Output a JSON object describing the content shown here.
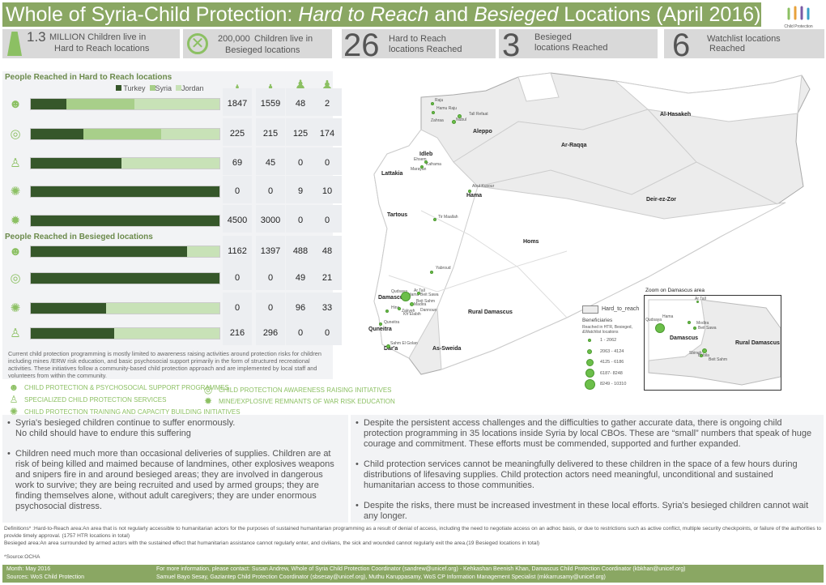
{
  "header": {
    "title_pre": "Whole of Syria-Child Protection: ",
    "title_em1": "Hard to Reach",
    "title_mid": " and ",
    "title_em2": "Besieged",
    "title_post": " Locations (April 2016)",
    "logo_text": "Child Protection"
  },
  "stats": [
    {
      "value": "1.3",
      "label1": "MILLION Children live in",
      "label2": "Hard to Reach locations",
      "icon": "road-icon"
    },
    {
      "value": "200,000",
      "label1": "Children live in",
      "label2": "Besieged locations",
      "icon": "blocked-icon"
    },
    {
      "value": "26",
      "label1": "Hard to Reach",
      "label2": "locations Reached"
    },
    {
      "value": "3",
      "label1": "Besieged",
      "label2": "locations Reached"
    },
    {
      "value": "6",
      "label1": "Watchlist locations",
      "label2": "Reached"
    }
  ],
  "chart_data": {
    "type": "bar",
    "stacked": "percent",
    "orientation": "horizontal",
    "legend": [
      "Turkey",
      "Syria",
      "Jordan"
    ],
    "legend_placement": "top-right",
    "colors": {
      "Turkey": "#36572a",
      "Syria": "#a8cf8a",
      "Jordan": "#c8e2b7"
    },
    "columns_icons": [
      "girl-icon",
      "boy-icon",
      "woman-icon",
      "man-icon"
    ],
    "hard_to_reach": {
      "title": "People Reached in Hard to Reach locations",
      "rows": [
        {
          "program": "CHILD PROTECTION & PSYCHOSOCIAL SUPPORT PROGRAMMES",
          "icon": "psychosocial-icon",
          "Turkey": 19,
          "Syria": 36,
          "Jordan": 45,
          "counts": [
            1847,
            1559,
            48,
            2
          ]
        },
        {
          "program": "CHILD PROTECTION AWARENESS RAISING INITIATIVES",
          "icon": "awareness-icon",
          "Turkey": 28,
          "Syria": 41,
          "Jordan": 31,
          "counts": [
            225,
            215,
            125,
            174
          ]
        },
        {
          "program": "SPECIALIZED CHILD PROTECTION SERVICES",
          "icon": "specialized-icon",
          "Turkey": 48,
          "Syria": 0,
          "Jordan": 52,
          "counts": [
            69,
            45,
            0,
            0
          ]
        },
        {
          "program": "CHILD PROTECTION TRAINING AND CAPACITY BUILDING INITIATIVES",
          "icon": "lightbulb-icon",
          "Turkey": 100,
          "Syria": 0,
          "Jordan": 0,
          "counts": [
            0,
            0,
            9,
            10
          ]
        },
        {
          "program": "MINE/EXPLOSIVE REMNANTS OF WAR RISK EDUCATION",
          "icon": "mine-icon",
          "Turkey": 100,
          "Syria": 0,
          "Jordan": 0,
          "counts": [
            4500,
            3000,
            0,
            0
          ]
        }
      ]
    },
    "besieged": {
      "title": "People Reached in Besieged locations",
      "rows": [
        {
          "icon": "psychosocial-icon",
          "Turkey": 83,
          "Syria": 0,
          "Jordan": 17,
          "counts": [
            1162,
            1397,
            488,
            48
          ]
        },
        {
          "icon": "awareness-icon",
          "Turkey": 100,
          "Syria": 0,
          "Jordan": 0,
          "counts": [
            0,
            0,
            49,
            21
          ]
        },
        {
          "icon": "lightbulb-icon",
          "Turkey": 40,
          "Syria": 0,
          "Jordan": 60,
          "counts": [
            0,
            0,
            96,
            33
          ]
        },
        {
          "icon": "specialized-icon",
          "Turkey": 44,
          "Syria": 0,
          "Jordan": 56,
          "counts": [
            216,
            296,
            0,
            0
          ]
        }
      ]
    }
  },
  "left_paragraph": "Current child protection programming is mostly limited to awareness raising activities around protection risks for children including mines /ERW risk education, and basic psychosocial support primarily in the form of structured recreational activities. These initiatives follow a community-based child protection approach and  are implemented by local staff and volunteers from within the community.",
  "legend_items": [
    "CHILD PROTECTION & PSYCHOSOCIAL SUPPORT PROGRAMMES",
    "SPECIALIZED CHILD PROTECTION SERVICES",
    "CHILD PROTECTION TRAINING AND CAPACITY BUILDING INITIATIVES",
    "CHILD PROTECTION AWARENESS RAISING INITIATIVES",
    "MINE/EXPLOSIVE REMNANTS OF WAR RISK EDUCATION"
  ],
  "map": {
    "governorates": [
      "Al-Hasakeh",
      "Aleppo",
      "Ar-Raqqa",
      "Idleb",
      "Lattakia",
      "Hama",
      "Deir-ez-Zor",
      "Tartous",
      "Homs",
      "Damascus",
      "Rural Damascus",
      "Quneitra",
      "Dar'a",
      "As-Sweida"
    ],
    "locations": [
      "Raju",
      "Hamu Raju",
      "Tall Refaat",
      "Zahraa",
      "Nubul",
      "Ehsem",
      "Kaframa",
      "Marayan",
      "Abul Kusour",
      "Tir Maallah",
      "Yabroud",
      "Qudsaya",
      "Ar Tall",
      "Hama",
      "Beit Sawa",
      "Beit Sahm",
      "Madira",
      "Hina",
      "Zakyeh",
      "Dannoun",
      "Kfr Elabih",
      "Quneitra",
      "Sahm El Golan"
    ],
    "legend": {
      "htr": "Hard_to_reach",
      "title": "Beneficiaries",
      "subtitle1": "Reached in HTR, Besieged,",
      "subtitle2": "&Watchlist locations",
      "classes": [
        "1 - 2062",
        "2063 - 4124",
        "4125 - 6186",
        "6187- 8248",
        "8249 - 10310"
      ]
    },
    "inset": {
      "title": "Zoom on Damascus area",
      "labels": [
        "Ar Tall",
        "Hama",
        "Qudsaya",
        "Modira",
        "Beit Sawa",
        "Damascus",
        "Rural Damascus",
        "Sbineh",
        "Babila",
        "Beit Sahm"
      ]
    },
    "colors": {
      "htr_fill": "#ececec",
      "dot": "#6cbf4a"
    }
  },
  "bullets_left": [
    "Syria's besieged children continue to suffer enormously.\nNo child should have to endure this suffering",
    "Children need much more than occasional deliveries of supplies. Children are at risk of being killed and maimed because of landmines, other explosives weapons and snipers fire in and around besieged areas; they are involved in dangerous work to survive; they are being recruited and used by armed groups; they are finding themselves alone, without adult caregivers; they are under enormous psychosocial distress."
  ],
  "bullets_right": [
    "Despite the persistent access challenges and the difficulties to gather accurate data, there is ongoing child protection programming in 35 locations inside Syria by local CBOs. These are “small” numbers that speak of huge courage and commitment. These efforts must be commended, supported and further expanded.",
    "Child protection services cannot be meaningfully delivered to these children in the space of a few hours during distributions of lifesaving supplies. Child protection actors need meaningful, unconditional and sustained humanitarian access to those communities.",
    "Despite the risks, there must be increased investment in these local efforts. Syria's besieged children cannot wait any longer."
  ],
  "definitions": {
    "htr": "Definitions* :Hard-to-Reach area:An area that is not regularly accessible to humanitarian actors for the purposes of sustained humanitarian programming as a result of denial of access, including the need to negotiate access on an adhoc basis, or due to restrictions  such as active conflict, multiple security checkpoints, or failure of the authorities to provide timely approval. (1757 HTR locations in total)",
    "besieged": "Besieged area:An area surrounded by armed actors with the sustained effect that humanitarian assistance cannot regularly enter, and civilians, the sick and wounded cannot regularly exit the area.(19 Besieged locations in total)",
    "source": "*Source:OCHA"
  },
  "footer": {
    "month": "Month: May 2016",
    "sources": "Sources: WoS Child Protection",
    "contact1": "For more information, please contact: Susan Andrew, Whole of Syria Child Protection Coordinator (sandrew@unicef.org)  - Kehkashan Beenish Khan, Damascus Child Protection Coordinator (kbkhan@unicef.org)",
    "contact2": "Samuel Bayo Sesay, Gaziantep Child Protection Coordinator (sbsesay@unicef.org), Muthu Karuppasamy, WoS CP Information Management Specialist (mkkarrusamy@unicef.org)"
  }
}
